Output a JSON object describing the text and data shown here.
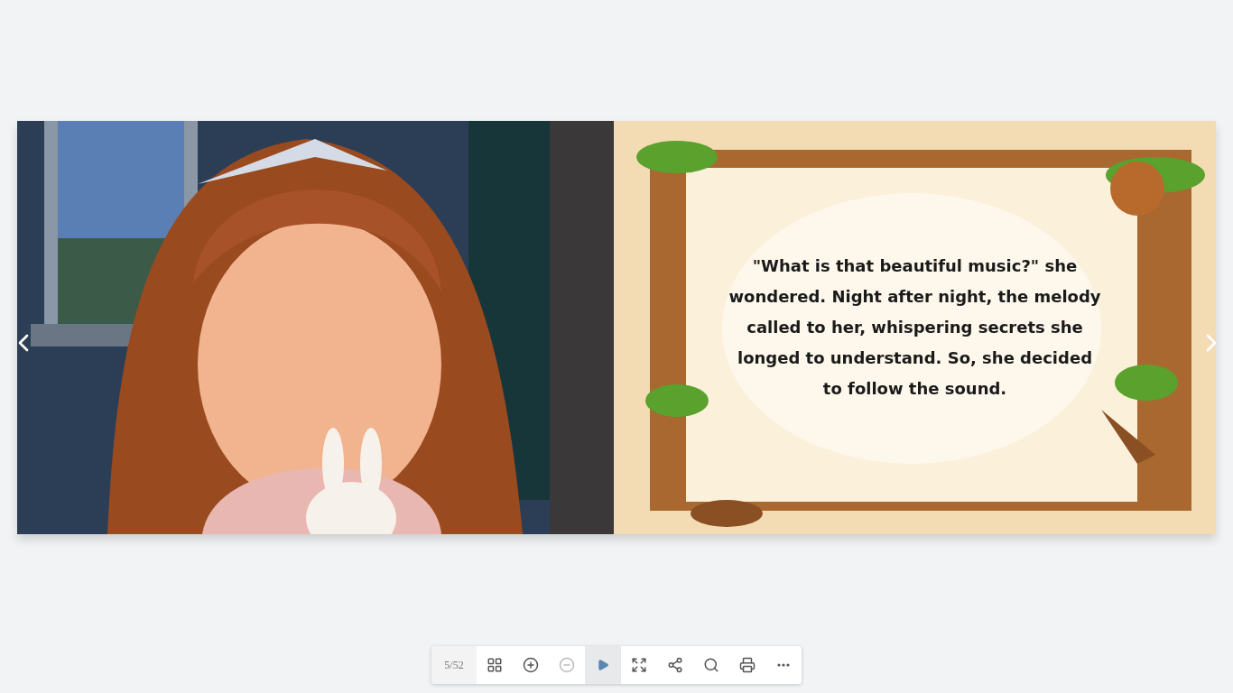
{
  "book": {
    "pages": [
      {
        "kind": "picture"
      },
      {
        "kind": "text",
        "text": "\"What is that beautiful music?\" she wondered. Night after night, the melody called to her, whispering secrets she longed to understand. So, she decided to follow the sound."
      }
    ]
  },
  "toolbar": {
    "page_counter": "5/52",
    "buttons": [
      {
        "kind": "grid",
        "disabled": false,
        "selected": false
      },
      {
        "kind": "zoom-in",
        "disabled": false,
        "selected": false
      },
      {
        "kind": "zoom-out",
        "disabled": true,
        "selected": false
      },
      {
        "kind": "play",
        "disabled": false,
        "selected": true
      },
      {
        "kind": "fullscreen",
        "disabled": false,
        "selected": false
      },
      {
        "kind": "share",
        "disabled": false,
        "selected": false
      },
      {
        "kind": "search",
        "disabled": false,
        "selected": false
      },
      {
        "kind": "print",
        "disabled": false,
        "selected": false
      },
      {
        "kind": "more",
        "disabled": false,
        "selected": false
      }
    ]
  }
}
